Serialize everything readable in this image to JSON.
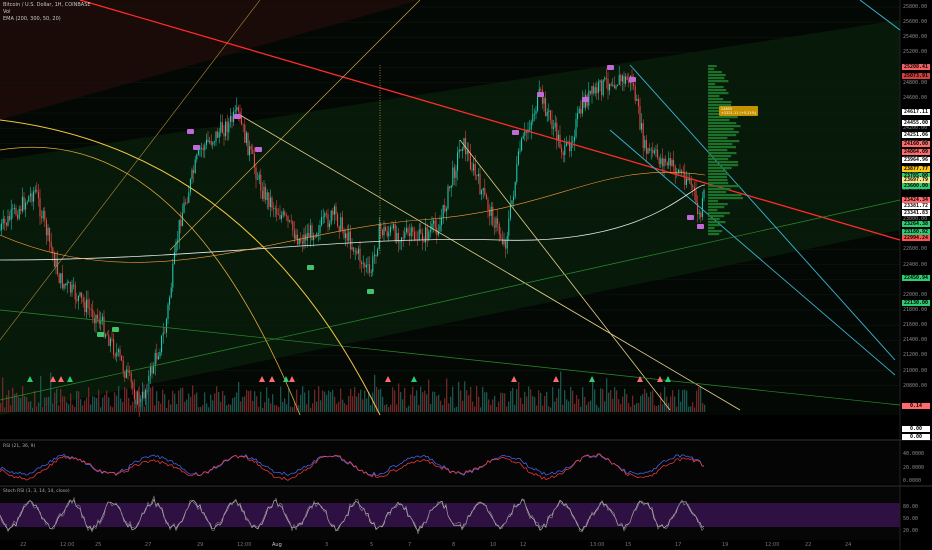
{
  "header": {
    "title": "Bitcoin / U.S. Dollar, 1H, COINBASE",
    "sub1": "Vol",
    "sub2": "EMA (200, 300, 50, 20)"
  },
  "price_axis": {
    "ticks": [
      "25800.00",
      "25600.00",
      "25400.00",
      "25200.00",
      "25000.00",
      "24800.00",
      "24600.00",
      "24400.00",
      "24200.00",
      "24000.00",
      "23800.00",
      "23600.00",
      "23400.00",
      "23200.00",
      "23000.00",
      "22800.00",
      "22600.00",
      "22400.00",
      "22200.00",
      "22000.00",
      "21800.00",
      "21600.00",
      "21400.00",
      "21200.00",
      "21000.00",
      "20800.00"
    ],
    "badges": [
      {
        "text": "25208.41",
        "color": "#f06060"
      },
      {
        "text": "25073.91",
        "color": "#d04040"
      },
      {
        "text": "24617.11",
        "color": "#ffffff"
      },
      {
        "text": "24455.00",
        "color": "#ffffff"
      },
      {
        "text": "24251.06",
        "color": "#ffffff"
      },
      {
        "text": "24160.00",
        "color": "#ff6b6b"
      },
      {
        "text": "24064.09",
        "color": "#ff6b6b"
      },
      {
        "text": "23964.96",
        "color": "#ffffff"
      },
      {
        "text": "23877.77",
        "color": "#f5c518"
      },
      {
        "text": "23785.00",
        "color": "#2ecc71"
      },
      {
        "text": "23697.79",
        "color": "#ffe08a"
      },
      {
        "text": "23600.00",
        "color": "#2ecc71"
      },
      {
        "text": "23424.34",
        "color": "#ff6b6b"
      },
      {
        "text": "23381.72",
        "color": "#ffffff"
      },
      {
        "text": "23341.83",
        "color": "#ffffff"
      },
      {
        "text": "23264.38",
        "color": "#2ecc71"
      },
      {
        "text": "23180.92",
        "color": "#2ecc71"
      },
      {
        "text": "22994.24",
        "color": "#ff5050"
      },
      {
        "text": "22450.94",
        "color": "#2ecc71"
      },
      {
        "text": "22130.00",
        "color": "#2ecc71"
      }
    ],
    "low_badges": [
      {
        "text": "0.14",
        "color": "#ff6b6b"
      },
      {
        "text": "0.00",
        "color": "#ffffff"
      },
      {
        "text": "0.00",
        "color": "#ffffff"
      }
    ]
  },
  "rsi_pane": {
    "title": "RSI (21, 36, 9)",
    "ticks": [
      "40.0000",
      "20.0000",
      "0.0000"
    ]
  },
  "stoch_pane": {
    "title": "Stoch RSI (3, 3, 14, 14, close)",
    "ticks": [
      "80.00",
      "50.00",
      "20.00"
    ]
  },
  "time_axis": [
    "22",
    "12:00",
    "25",
    "27",
    "29",
    "12:00",
    "Aug",
    "3",
    "5",
    "7",
    "8",
    "10",
    "12",
    "13:00",
    "15",
    "17",
    "19",
    "12:00",
    "22",
    "24"
  ],
  "info_tag": {
    "line1": "24655",
    "line2": "+1221.11 (+5.21%)"
  }
}
